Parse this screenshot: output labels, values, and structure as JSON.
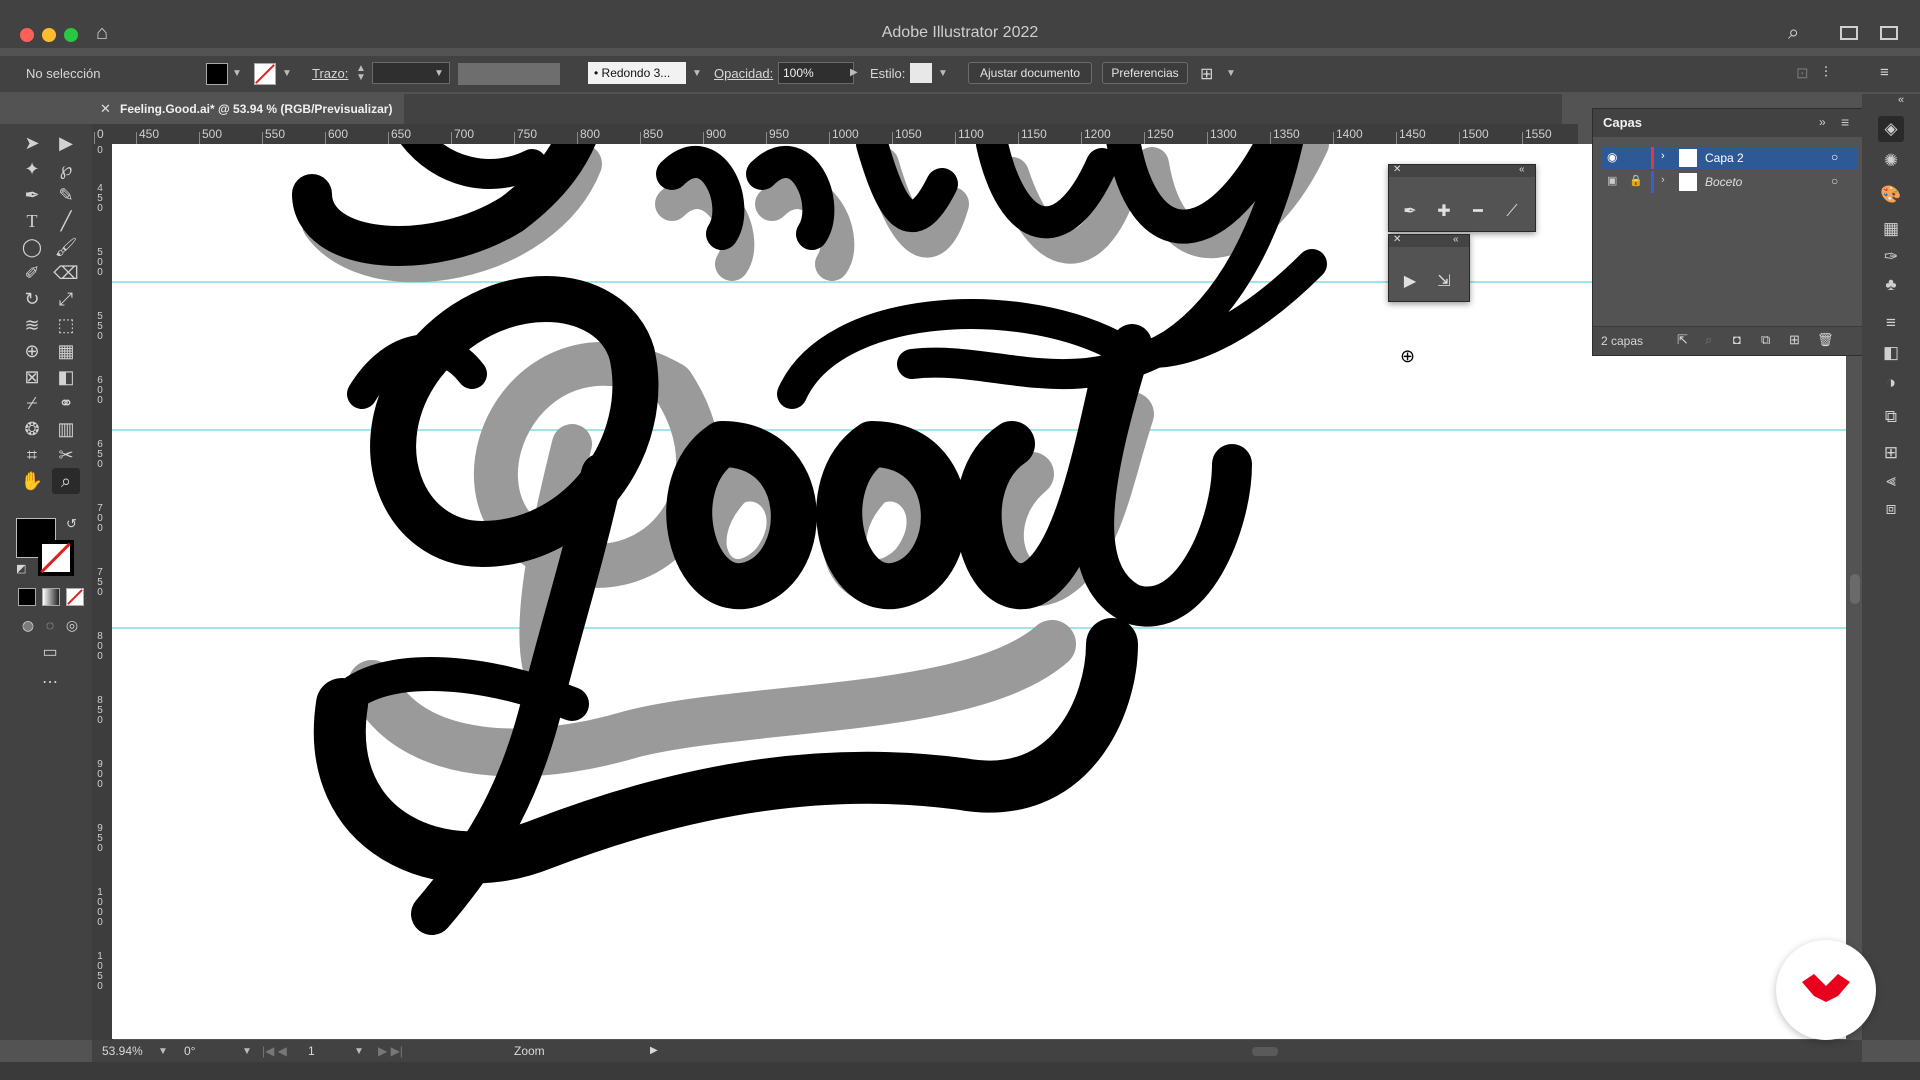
{
  "app": {
    "title": "Adobe Illustrator 2022"
  },
  "control_bar": {
    "selection_status": "No selección",
    "stroke_label": "Trazo:",
    "brush_label": "Redondo 3...",
    "opacity_label": "Opacidad:",
    "opacity_value": "100%",
    "style_label": "Estilo:",
    "document_setup_button": "Ajustar documento",
    "preferences_button": "Preferencias"
  },
  "document_tab": {
    "label": "Feeling.Good.ai* @ 53.94 % (RGB/Previsualizar)"
  },
  "rulers": {
    "horizontal_ticks": [
      "0",
      "450",
      "500",
      "550",
      "600",
      "650",
      "700",
      "750",
      "800",
      "850",
      "900",
      "950",
      "1000",
      "1050",
      "1100",
      "1150",
      "1200",
      "1250",
      "1300",
      "1350",
      "1400",
      "1450",
      "1500",
      "1550"
    ],
    "vertical_ticks": [
      "0",
      "450",
      "500",
      "550",
      "600",
      "650",
      "700",
      "750",
      "800",
      "850",
      "900",
      "950",
      "1000",
      "1050"
    ]
  },
  "layers_panel": {
    "title": "Capas",
    "layers": [
      {
        "name": "Capa 2",
        "color": "#e5383b",
        "selected": true,
        "visible": true,
        "locked": false
      },
      {
        "name": "Boceto",
        "color": "#3b5bdb",
        "selected": false,
        "visible": true,
        "locked": true
      }
    ],
    "layer_count": "2 capas"
  },
  "status_bar": {
    "zoom": "53.94%",
    "rotation": "0°",
    "artboard": "1",
    "active_tool": "Zoom"
  },
  "artwork": {
    "text": "Feeling Good",
    "shadow_color": "#9a9a9a",
    "ink_color": "#000000",
    "guide_color": "#7fdde0"
  },
  "colors": {
    "accent": "#2d7be0",
    "badge": "#e8001c"
  }
}
